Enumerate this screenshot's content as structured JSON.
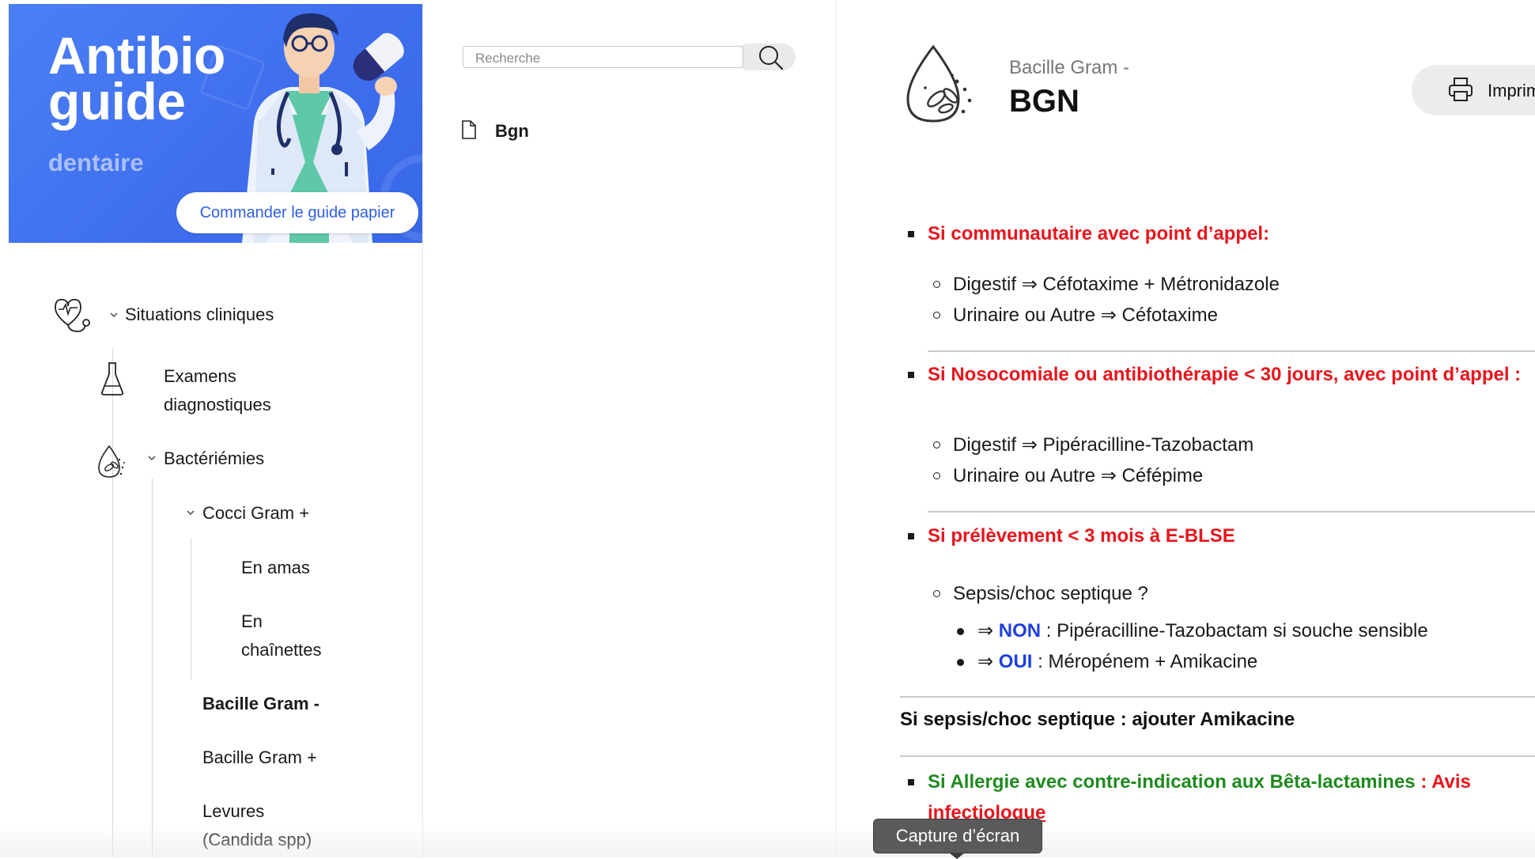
{
  "banner": {
    "title_line1": "Antibio",
    "title_line2": "guide",
    "subtitle": "dentaire",
    "order_button": "Commander le guide papier"
  },
  "nav": {
    "situations": "Situations cliniques",
    "examens_line1": "Examens",
    "examens_line2": "diagnostiques",
    "bacteriemies": "Bactériémies",
    "cocci": "Cocci Gram +",
    "en_amas": "En amas",
    "en_chainettes_line1": "En",
    "en_chainettes_line2": "chaînettes",
    "bacille_neg": "Bacille Gram -",
    "bacille_pos": "Bacille Gram +",
    "levures_line1": "Levures",
    "levures_line2": "(Candida spp)"
  },
  "search": {
    "placeholder": "Recherche",
    "results": [
      "Bgn"
    ]
  },
  "page": {
    "kicker": "Bacille Gram -",
    "title": "BGN",
    "print_label": "Imprimer"
  },
  "content": {
    "s1_heading": "Si communautaire avec point d’appel:",
    "s1_item1": "Digestif ⇒ Céfotaxime + Métronidazole",
    "s1_item2": "Urinaire ou Autre ⇒ Céfotaxime",
    "s2_heading": "Si Nosocomiale ou antibiothérapie < 30 jours, avec point d’appel :",
    "s2_item1": "Digestif ⇒ Pipéracilline-Tazobactam",
    "s2_item2": "Urinaire ou Autre ⇒ Céfépime",
    "s3_heading": "Si prélèvement < 3 mois à E-BLSE",
    "s3_item1": "Sepsis/choc septique ?",
    "s3_sub1_arrow": "⇒",
    "s3_sub1_keyword": "NON",
    "s3_sub1_text": ": Pipéracilline-Tazobactam si souche sensible",
    "s3_sub2_arrow": "⇒",
    "s3_sub2_keyword": "OUI",
    "s3_sub2_text": ": Méropénem + Amikacine",
    "sepsis_note": "Si sepsis/choc septique : ajouter Amikacine",
    "s4_heading_green": "Si Allergie avec contre-indication aux Bêta-lactamines",
    "s4_heading_red1": ": Avis",
    "s4_heading_red2": "infectiologue"
  },
  "tooltip": {
    "text": "Capture d’écran"
  },
  "colors": {
    "banner_blue": "#4176f0",
    "alert_red": "#e8151c",
    "keyword_blue": "#1d3fe0",
    "allergy_green": "#1e8a1e"
  },
  "icons": {
    "situations": "stethoscope-heart-icon",
    "examens": "flask-icon",
    "bacteriemies": "blood-drop-bacteria-icon",
    "result": "document-icon",
    "search": "search-icon",
    "print": "printer-icon"
  }
}
